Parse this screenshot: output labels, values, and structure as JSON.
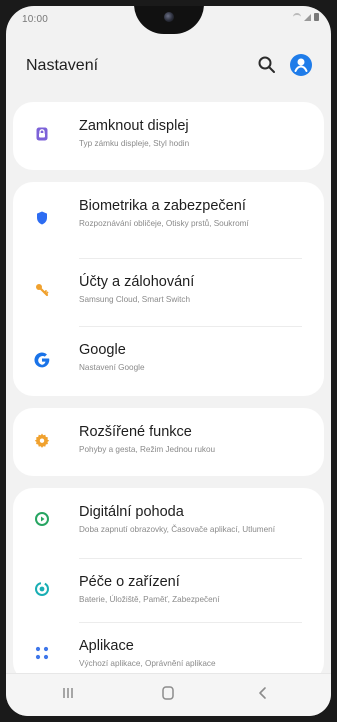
{
  "status_bar": {
    "time": "10:00"
  },
  "header": {
    "title": "Nastavení",
    "search_icon": "search-icon",
    "profile_icon": "profile-icon"
  },
  "colors": {
    "background": "#f2f2f2",
    "card": "#ffffff",
    "title": "#1e1e1e",
    "subtitle": "#8a8a8a",
    "profile": "#1f7ce9",
    "purple": "#7c62d8",
    "blue": "#2d6cf2",
    "orange": "#f0a12e",
    "green": "#27a562",
    "teal": "#19aeb4",
    "app_blue": "#3f77ea"
  },
  "items": [
    {
      "title": "Zamknout displej",
      "subtitle": "Typ zámku displeje, Styl hodin",
      "icon": "lock-screen-icon"
    },
    {
      "title": "Biometrika a zabezpečení",
      "subtitle": "Rozpoznávání obličeje, Otisky prstů, Soukromí",
      "icon": "shield-icon"
    },
    {
      "title": "Účty a zálohování",
      "subtitle": "Samsung Cloud, Smart Switch",
      "icon": "key-icon"
    },
    {
      "title": "Google",
      "subtitle": "Nastavení Google",
      "icon": "google-icon"
    },
    {
      "title": "Rozšířené funkce",
      "subtitle": "Pohyby a gesta, Režim Jednou rukou",
      "icon": "gear-icon"
    },
    {
      "title": "Digitální pohoda",
      "subtitle": "Doba zapnutí obrazovky, Časovače aplikací, Utlumení",
      "icon": "digital-wellbeing-icon"
    },
    {
      "title": "Péče o zařízení",
      "subtitle": "Baterie, Úložiště, Paměť, Zabezpečení",
      "icon": "device-care-icon"
    },
    {
      "title": "Aplikace",
      "subtitle": "Výchozí aplikace, Oprávnění aplikace",
      "icon": "apps-icon"
    }
  ],
  "navigation": {
    "recent_icon": "recent-apps-icon",
    "home_icon": "home-icon",
    "back_icon": "back-icon"
  }
}
